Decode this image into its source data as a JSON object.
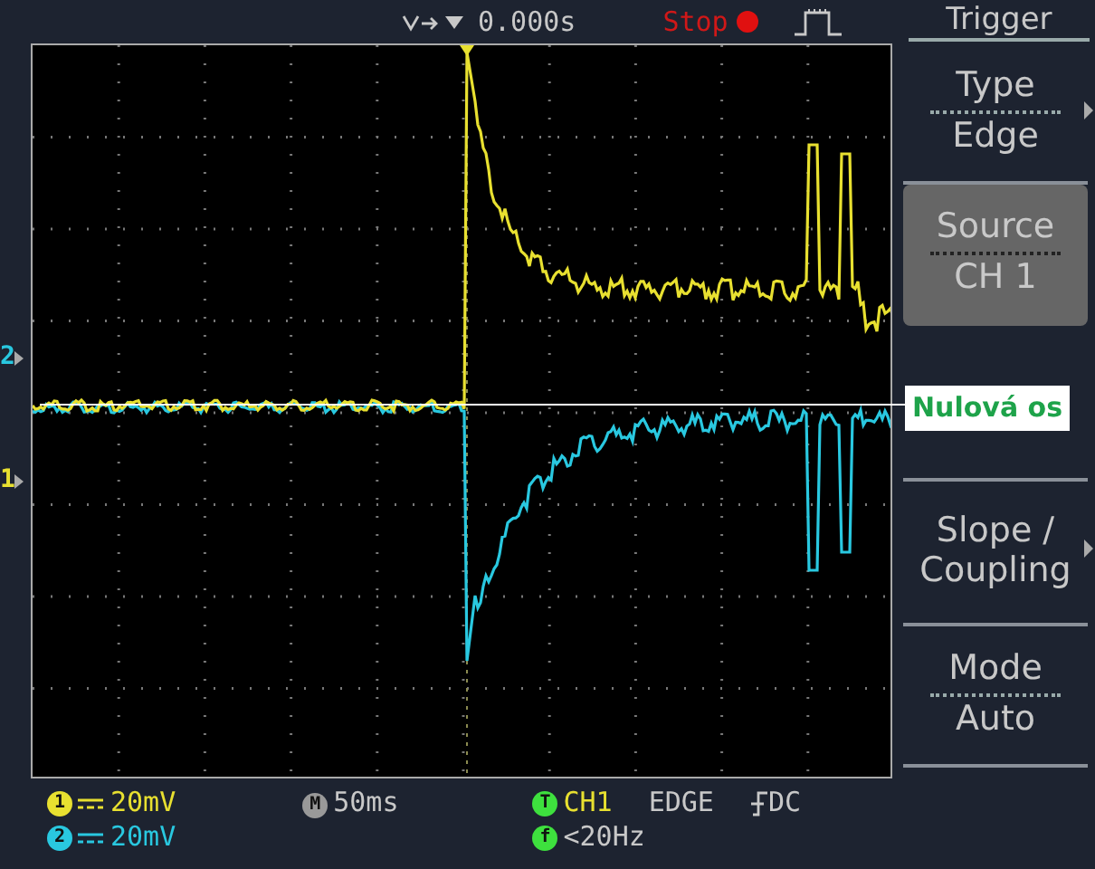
{
  "top_bar": {
    "trigger_position": "0.000s",
    "run_state": "Stop"
  },
  "menu": {
    "title": "Trigger",
    "items": [
      {
        "kind": "pair",
        "label": "Type",
        "value": "Edge",
        "has_submenu": true,
        "selected": false
      },
      {
        "kind": "pair",
        "label": "Source",
        "value": "CH 1",
        "has_submenu": false,
        "selected": true
      },
      {
        "kind": "blank"
      },
      {
        "kind": "single",
        "label": "Slope / Coupling",
        "has_submenu": true,
        "selected": false
      },
      {
        "kind": "pair",
        "label": "Mode",
        "value": "Auto",
        "has_submenu": false,
        "selected": false
      }
    ]
  },
  "channel_markers": [
    {
      "label": "2",
      "color": "#29c8e0"
    },
    {
      "label": "1",
      "color": "#e8e030"
    }
  ],
  "annotation": {
    "text": "Nulová os"
  },
  "status": {
    "channels": [
      {
        "badge": "1",
        "scale": "20mV",
        "color": "#e8e030"
      },
      {
        "badge": "2",
        "scale": "20mV",
        "color": "#29c8e0"
      }
    ],
    "timebase": {
      "badge": "M",
      "value": "50ms"
    },
    "trigger": {
      "badge": "T",
      "source": "CH1",
      "type": "EDGE",
      "coupling": "DC"
    },
    "frequency": {
      "badge": "f",
      "value": "<20Hz"
    }
  }
}
